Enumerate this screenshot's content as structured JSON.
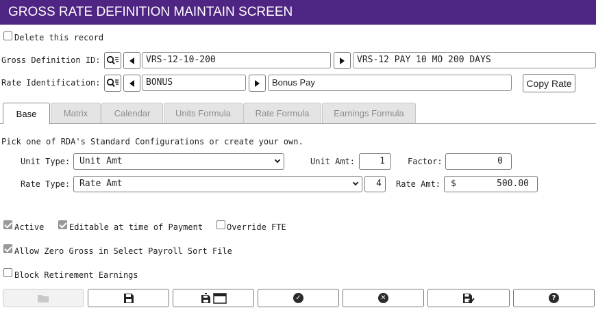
{
  "window": {
    "title": "GROSS RATE DEFINITION MAINTAIN SCREEN"
  },
  "delete_record": {
    "label": "Delete this record",
    "checked": false
  },
  "gross_definition": {
    "label": "Gross Definition ID:",
    "id_value": "VRS-12-10-200",
    "description": "VRS-12 PAY 10 MO 200 DAYS"
  },
  "rate_identification": {
    "label": "Rate Identification:",
    "id_value": "BONUS",
    "description": "Bonus Pay",
    "copy_button": "Copy Rate"
  },
  "tabs": [
    {
      "label": "Base",
      "active": true
    },
    {
      "label": "Matrix",
      "active": false
    },
    {
      "label": "Calendar",
      "active": false
    },
    {
      "label": "Units Formula",
      "active": false
    },
    {
      "label": "Rate Formula",
      "active": false
    },
    {
      "label": "Earnings Formula",
      "active": false
    }
  ],
  "base": {
    "instructions": "Pick one of RDA's Standard Configurations or create your own.",
    "unit_type": {
      "label": "Unit Type:",
      "value": "Unit Amt"
    },
    "unit_amt": {
      "label": "Unit Amt:",
      "value": "1"
    },
    "factor": {
      "label": "Factor:",
      "value": "0"
    },
    "rate_type": {
      "label": "Rate Type:",
      "value": "Rate Amt",
      "code": "4"
    },
    "rate_amt": {
      "label": "Rate Amt:",
      "currency": "$",
      "value": "500.00"
    }
  },
  "options": {
    "active": {
      "label": "Active",
      "checked": true
    },
    "editable": {
      "label": "Editable at time of Payment",
      "checked": true
    },
    "override_fte": {
      "label": "Override FTE",
      "checked": false
    },
    "allow_zero_gross": {
      "label": "Allow Zero Gross in Select Payroll Sort File",
      "checked": true
    },
    "block_retirement": {
      "label": "Block Retirement Earnings",
      "checked": false
    }
  },
  "footer": {
    "buttons": [
      {
        "icon": "folder-icon",
        "disabled": true
      },
      {
        "icon": "save-icon",
        "disabled": false
      },
      {
        "icon": "save-and-new-icon",
        "disabled": false
      },
      {
        "icon": "check-circle-icon",
        "disabled": false
      },
      {
        "icon": "cancel-circle-icon",
        "disabled": false
      },
      {
        "icon": "save-check-icon",
        "disabled": false
      },
      {
        "icon": "help-icon",
        "disabled": false
      }
    ]
  }
}
